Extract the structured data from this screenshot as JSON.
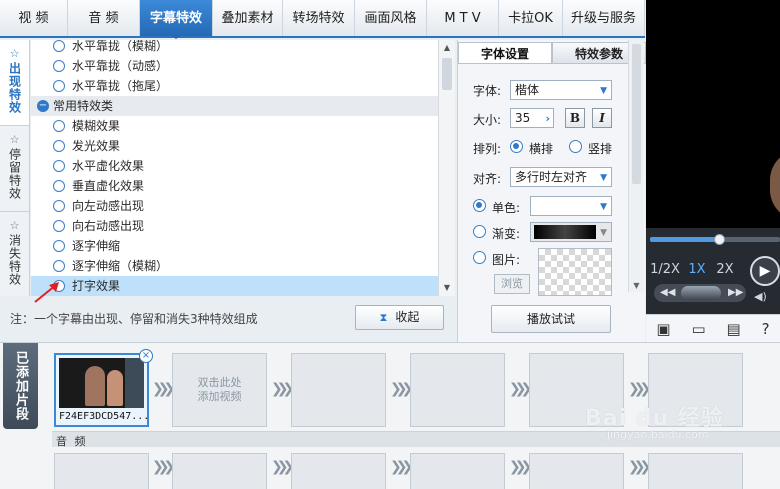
{
  "tabs": [
    {
      "label": "视  频"
    },
    {
      "label": "音  频"
    },
    {
      "label": "字幕特效"
    },
    {
      "label": "叠加素材"
    },
    {
      "label": "转场特效"
    },
    {
      "label": "画面风格"
    },
    {
      "label": "M T V"
    },
    {
      "label": "卡拉OK"
    },
    {
      "label": "升级与服务"
    }
  ],
  "vtabs": [
    {
      "label": "出现特效"
    },
    {
      "label": "停留特效"
    },
    {
      "label": "消失特效"
    }
  ],
  "effects": {
    "partial_top": "水平靠拢（模糊）",
    "items_before": [
      "水平靠拢（动感）",
      "水平靠拢（拖尾）"
    ],
    "group": "常用特效类",
    "items": [
      "模糊效果",
      "发光效果",
      "水平虚化效果",
      "垂直虚化效果",
      "向左动感出现",
      "向右动感出现",
      "逐字伸缩",
      "逐字伸缩（模糊）",
      "打字效果"
    ],
    "selected": "打字效果"
  },
  "note": "注：一个字幕由出现、停留和消失3种特效组成",
  "collapse_label": "收起",
  "font_panel": {
    "tabs": [
      "字体设置",
      "特效参数"
    ],
    "font_label": "字体:",
    "font_value": "楷体",
    "size_label": "大小:",
    "size_value": "35",
    "bold": "B",
    "italic": "I",
    "arrange_label": "排列:",
    "arrange_h": "横排",
    "arrange_v": "竖排",
    "align_label": "对齐:",
    "align_value": "多行时左对齐",
    "mono_label": "单色:",
    "gradient_label": "渐变:",
    "image_label": "图片:",
    "browse_label": "浏览",
    "preview_label": "播放试试"
  },
  "player": {
    "speeds": [
      "1/2X",
      "1X",
      "2X"
    ],
    "active_speed": "1X",
    "progress": 0.53
  },
  "timeline": {
    "side_label": "已添加片段",
    "clip_name": "F24EF3DCD547...",
    "add_hint": "双击此处添加视频",
    "audio_label": "音 频"
  },
  "watermark": {
    "main": "Bai du 经验",
    "sub": "jingyan.baidu.com"
  },
  "colors": {
    "accent": "#2c74c0",
    "selected_row": "#bfe0fa",
    "pointer": "#e02020"
  }
}
